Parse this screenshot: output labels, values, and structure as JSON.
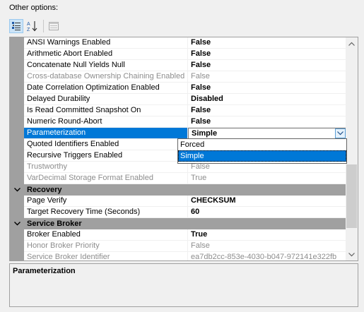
{
  "header": {
    "label": "Other options:"
  },
  "toolbar": {
    "categorized": "categorized-icon",
    "alphabetical": "sort-az-icon",
    "property_pages": "property-pages-icon"
  },
  "rows_top": [
    {
      "name": "ANSI Warnings Enabled",
      "value": "False",
      "readonly": false
    },
    {
      "name": "Arithmetic Abort Enabled",
      "value": "False",
      "readonly": false
    },
    {
      "name": "Concatenate Null Yields Null",
      "value": "False",
      "readonly": false
    },
    {
      "name": "Cross-database Ownership Chaining Enabled",
      "value": "False",
      "readonly": true
    },
    {
      "name": "Date Correlation Optimization Enabled",
      "value": "False",
      "readonly": false
    },
    {
      "name": "Delayed Durability",
      "value": "Disabled",
      "readonly": false
    },
    {
      "name": "Is Read Committed Snapshot On",
      "value": "False",
      "readonly": false
    },
    {
      "name": "Numeric Round-Abort",
      "value": "False",
      "readonly": false
    }
  ],
  "selected_row": {
    "name": "Parameterization",
    "value": "Simple"
  },
  "rows_after": [
    {
      "name": "Quoted Identifiers Enabled",
      "value": "",
      "readonly": false
    },
    {
      "name": "Recursive Triggers Enabled",
      "value": "",
      "readonly": false
    },
    {
      "name": "Trustworthy",
      "value": "False",
      "readonly": true
    },
    {
      "name": "VarDecimal Storage Format Enabled",
      "value": "True",
      "readonly": true
    }
  ],
  "categories": {
    "recovery": "Recovery",
    "service_broker": "Service Broker"
  },
  "recovery_rows": [
    {
      "name": "Page Verify",
      "value": "CHECKSUM"
    },
    {
      "name": "Target Recovery Time (Seconds)",
      "value": "60"
    }
  ],
  "broker_rows": [
    {
      "name": "Broker Enabled",
      "value": "True",
      "readonly": false
    },
    {
      "name": "Honor Broker Priority",
      "value": "False",
      "readonly": true
    },
    {
      "name": "Service Broker Identifier",
      "value": "ea7db2cc-853e-4030-b047-972141e322fb",
      "readonly": true
    }
  ],
  "dropdown": {
    "options": [
      "Forced",
      "Simple"
    ],
    "selected": "Simple"
  },
  "description": {
    "title": "Parameterization"
  },
  "colors": {
    "selection": "#0078d7",
    "margin": "#a0a0a0",
    "readonly_text": "#8d8d8d"
  }
}
